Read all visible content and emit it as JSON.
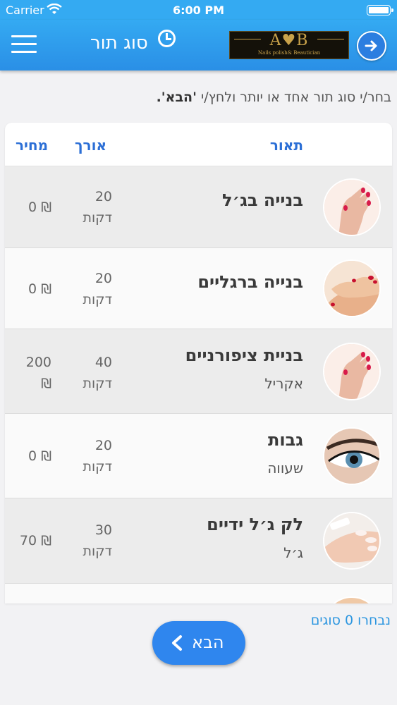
{
  "status_bar": {
    "carrier": "Carrier",
    "time": "6:00 PM"
  },
  "header": {
    "title": "סוג תור",
    "logo_main": "A♥B",
    "logo_sub": "Nails polish& Beautician"
  },
  "instruction": {
    "prefix": "בחר/י סוג תור אחד או יותר ולחץ/י ",
    "highlight": "'הבא'."
  },
  "table": {
    "headers": {
      "description": "תאור",
      "length": "אורך",
      "price": "מחיר"
    },
    "rows": [
      {
        "title": "בנייה בג׳ל",
        "subtitle": "",
        "length": "20",
        "unit": "דקות",
        "price": "0 ₪",
        "image": "nails-gel-photo"
      },
      {
        "title": "בנייה ברגליים",
        "subtitle": "",
        "length": "20",
        "unit": "דקות",
        "price": "0 ₪",
        "image": "feet-pedicure-photo"
      },
      {
        "title": "בניית ציפורניים",
        "subtitle": "אקריל",
        "length": "40",
        "unit": "דקות",
        "price": "200",
        "price_currency": "₪",
        "image": "nails-acrylic-photo"
      },
      {
        "title": "גבות",
        "subtitle": "שעווה",
        "length": "20",
        "unit": "דקות",
        "price": "0 ₪",
        "image": "eye-brows-photo"
      },
      {
        "title": "לק ג׳ל ידיים",
        "subtitle": "ג׳ל",
        "length": "30",
        "unit": "דקות",
        "price": "70 ₪",
        "image": "hand-gel-polish-photo"
      }
    ]
  },
  "footer": {
    "selected_count": "נבחרו 0 סוגים",
    "next_label": "הבא"
  },
  "colors": {
    "header_blue": "#34aaf2",
    "accent_blue": "#2c6fd6",
    "button_blue": "#2f86ee",
    "row_shade": "#ececec"
  }
}
